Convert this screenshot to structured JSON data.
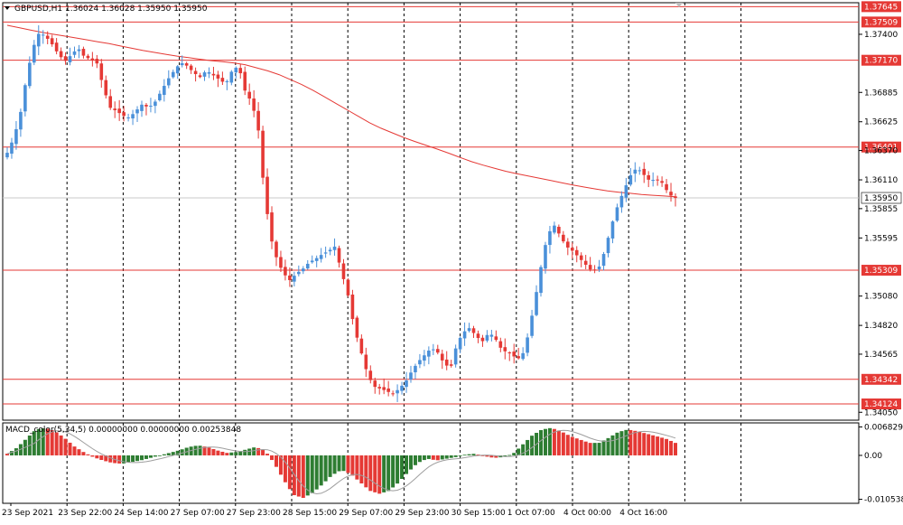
{
  "header": {
    "symbol": "GBPUSD,H1",
    "ohlc": "1.36024 1.36028 1.35950 1.35950"
  },
  "macd": {
    "label": "MACD_color(5,34,5) 0.00000000 0.00000000 0.00253848"
  },
  "colors": {
    "bull": "#4a90d9",
    "bear": "#e53935",
    "ma": "#e53935",
    "level": "#e53935",
    "hist_pos": "#2e7d32",
    "hist_neg": "#e53935",
    "signal": "#9e9e9e"
  },
  "chart_data": [
    {
      "type": "candlestick",
      "ylim": [
        1.3398,
        1.3768
      ],
      "price_ticks": [
        "1.37400",
        "1.36885",
        "1.36625",
        "1.36370",
        "1.36110",
        "1.35855",
        "1.35595",
        "1.35080",
        "1.34820",
        "1.34565",
        "1.34050"
      ],
      "price_tick_values": [
        1.374,
        1.36885,
        1.36625,
        1.3637,
        1.3611,
        1.35855,
        1.35595,
        1.3508,
        1.3482,
        1.34565,
        1.3405
      ],
      "levels": [
        {
          "label": "1.37645",
          "value": 1.37645
        },
        {
          "label": "1.37509",
          "value": 1.37509
        },
        {
          "label": "1.37170",
          "value": 1.3717
        },
        {
          "label": "1.36401",
          "value": 1.36401
        },
        {
          "label": "1.35309",
          "value": 1.35309
        },
        {
          "label": "1.34342",
          "value": 1.34342
        },
        {
          "label": "1.34124",
          "value": 1.34124
        }
      ],
      "current_price": {
        "label": "1.35950",
        "value": 1.3595
      },
      "x_labels": [
        "23 Sep 2021",
        "23 Sep 22:00",
        "24 Sep 14:00",
        "27 Sep 07:00",
        "27 Sep 23:00",
        "28 Sep 15:00",
        "29 Sep 07:00",
        "29 Sep 23:00",
        "30 Sep 15:00",
        "1 Oct 07:00",
        "4 Oct 00:00",
        "4 Oct 16:00"
      ],
      "close_path": [
        1.3635,
        1.3648,
        1.3668,
        1.3702,
        1.3728,
        1.3742,
        1.3738,
        1.3731,
        1.3722,
        1.3716,
        1.3722,
        1.3728,
        1.372,
        1.3718,
        1.3714,
        1.3692,
        1.3675,
        1.3672,
        1.3668,
        1.3666,
        1.3672,
        1.3678,
        1.3675,
        1.368,
        1.369,
        1.37,
        1.3708,
        1.3715,
        1.3712,
        1.3706,
        1.3702,
        1.3708,
        1.3704,
        1.37,
        1.3696,
        1.3708,
        1.3712,
        1.369,
        1.368,
        1.366,
        1.36,
        1.356,
        1.354,
        1.3528,
        1.3522,
        1.3528,
        1.3532,
        1.3538,
        1.3541,
        1.3545,
        1.3548,
        1.3552,
        1.353,
        1.351,
        1.348,
        1.346,
        1.344,
        1.3428,
        1.3426,
        1.3424,
        1.3421,
        1.3426,
        1.3432,
        1.3442,
        1.345,
        1.3456,
        1.3462,
        1.3458,
        1.3448,
        1.3444,
        1.3466,
        1.3476,
        1.348,
        1.3472,
        1.3468,
        1.3476,
        1.347,
        1.346,
        1.3458,
        1.3454,
        1.3452,
        1.3472,
        1.35,
        1.3532,
        1.356,
        1.3572,
        1.3562,
        1.3552,
        1.3548,
        1.3542,
        1.3536,
        1.353,
        1.3532,
        1.3548,
        1.357,
        1.3588,
        1.3602,
        1.3615,
        1.3622,
        1.3616,
        1.361,
        1.3612,
        1.3608,
        1.3598,
        1.3595
      ],
      "ma_path": [
        1.3748,
        1.3742,
        1.3737,
        1.3732,
        1.3726,
        1.3721,
        1.3717,
        1.3714,
        1.3706,
        1.3693,
        1.3676,
        1.3659,
        1.3647,
        1.3637,
        1.3626,
        1.3618,
        1.3612,
        1.3606,
        1.3601,
        1.3598,
        1.3596
      ]
    },
    {
      "type": "bar",
      "title": "MACD_color(5,34,5)",
      "y_ticks": [
        "0.0068296",
        "0.00",
        "-0.0105381"
      ],
      "y_tick_values": [
        0.0068296,
        0.0,
        -0.0105381
      ],
      "ylim": [
        -0.0115,
        0.0078
      ],
      "hist_path": [
        0.0004,
        0.0018,
        0.004,
        0.0062,
        0.0066,
        0.0058,
        0.0042,
        0.0022,
        0.0008,
        -0.0004,
        -0.0012,
        -0.0018,
        -0.002,
        -0.0016,
        -0.0012,
        -0.0006,
        0.0,
        0.0006,
        0.0012,
        0.002,
        0.0024,
        0.002,
        0.0012,
        0.0006,
        0.0008,
        0.0014,
        0.002,
        0.0012,
        -0.002,
        -0.006,
        -0.0095,
        -0.0102,
        -0.009,
        -0.007,
        -0.0048,
        -0.0035,
        -0.0045,
        -0.0065,
        -0.0085,
        -0.0092,
        -0.0085,
        -0.0065,
        -0.004,
        -0.0018,
        -0.0008,
        -0.0012,
        -0.0008,
        -0.0004,
        0.0002,
        0.0004,
        -0.0002,
        -0.0006,
        -0.0004,
        0.0004,
        0.0026,
        0.0048,
        0.0062,
        0.0066,
        0.0058,
        0.0046,
        0.0038,
        0.003,
        0.003,
        0.0042,
        0.0056,
        0.0062,
        0.0058,
        0.0052,
        0.0046,
        0.004,
        0.003
      ]
    }
  ]
}
